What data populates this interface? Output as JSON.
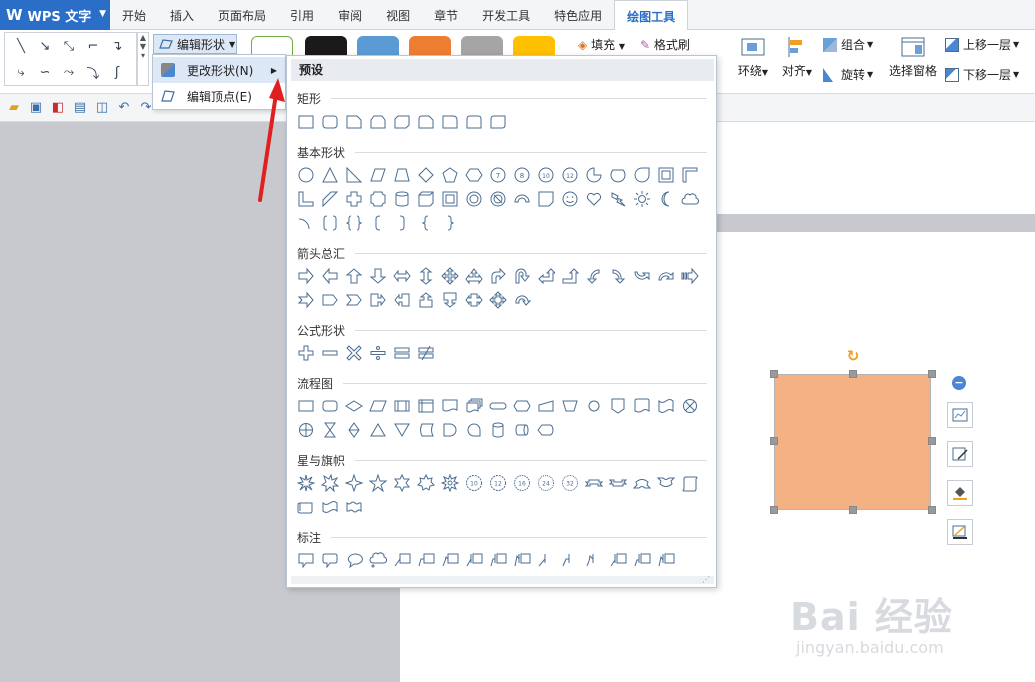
{
  "app": {
    "name": "WPS 文字"
  },
  "menu_tabs": [
    {
      "label": "开始"
    },
    {
      "label": "插入"
    },
    {
      "label": "页面布局"
    },
    {
      "label": "引用"
    },
    {
      "label": "审阅"
    },
    {
      "label": "视图"
    },
    {
      "label": "章节"
    },
    {
      "label": "开发工具"
    },
    {
      "label": "特色应用"
    },
    {
      "label": "绘图工具"
    }
  ],
  "active_tab": "绘图工具",
  "ribbon": {
    "edit_shape": "编辑形状",
    "fill": "填充",
    "format_painter": "格式刷",
    "wrap": "环绕",
    "align": "对齐",
    "group": "组合",
    "rotate": "旋转",
    "selection_pane": "选择窗格",
    "bring_forward": "上移一层",
    "send_backward": "下移一层",
    "swatch_colors": [
      "#ffffff",
      "#1a1a1a",
      "#5b9bd5",
      "#ed7d31",
      "#a5a5a5",
      "#ffc000"
    ]
  },
  "context_menu": {
    "change_shape": "更改形状(N)",
    "edit_points": "编辑顶点(E)"
  },
  "shape_panel": {
    "header": "预设",
    "sections": {
      "rect": "矩形",
      "basic": "基本形状",
      "arrows": "箭头总汇",
      "equation": "公式形状",
      "flowchart": "流程图",
      "stars": "星与旗帜",
      "callouts": "标注"
    }
  },
  "shape": {
    "fill_color": "#f4b183"
  },
  "watermark": {
    "text": "Bai 经验",
    "url": "jingyan.baidu.com"
  }
}
